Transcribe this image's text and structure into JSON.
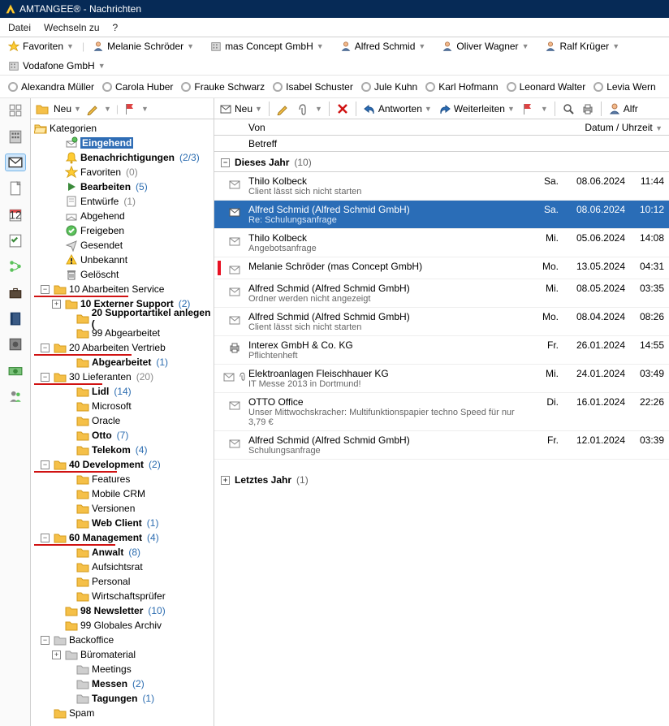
{
  "title": "AMTANGEE® - Nachrichten",
  "menu": {
    "items": [
      "Datei",
      "Wechseln zu",
      "?"
    ]
  },
  "favbar": {
    "favorites_label": "Favoriten",
    "items": [
      {
        "name": "Melanie Schröder",
        "type": "person"
      },
      {
        "name": "mas Concept GmbH",
        "type": "company"
      },
      {
        "name": "Alfred Schmid",
        "type": "person"
      },
      {
        "name": "Oliver Wagner",
        "type": "person"
      },
      {
        "name": "Ralf Krüger",
        "type": "person"
      },
      {
        "name": "Vodafone GmbH",
        "type": "company"
      }
    ]
  },
  "contactbar": {
    "items": [
      "Alexandra Müller",
      "Carola Huber",
      "Frauke Schwarz",
      "Isabel Schuster",
      "Jule Kuhn",
      "Karl Hofmann",
      "Leonard Walter",
      "Levia Wern"
    ]
  },
  "tree_toolbar": {
    "new_label": "Neu"
  },
  "tree": {
    "root": "Kategorien",
    "nodes": [
      {
        "ind": 1,
        "exp": "",
        "icon": "inbox",
        "label": "Eingehend",
        "sel": true,
        "bold": true
      },
      {
        "ind": 1,
        "exp": "",
        "icon": "bell",
        "label": "Benachrichtigungen",
        "cnt": "(2/3)",
        "bold": true
      },
      {
        "ind": 1,
        "exp": "",
        "icon": "star",
        "label": "Favoriten",
        "cnt": "(0)"
      },
      {
        "ind": 1,
        "exp": "",
        "icon": "play",
        "label": "Bearbeiten",
        "cnt": "(5)",
        "bold": true
      },
      {
        "ind": 1,
        "exp": "",
        "icon": "draft",
        "label": "Entwürfe",
        "cnt": "(1)"
      },
      {
        "ind": 1,
        "exp": "",
        "icon": "out",
        "label": "Abgehend"
      },
      {
        "ind": 1,
        "exp": "",
        "icon": "check",
        "label": "Freigeben"
      },
      {
        "ind": 1,
        "exp": "",
        "icon": "sent",
        "label": "Gesendet"
      },
      {
        "ind": 1,
        "exp": "",
        "icon": "warn",
        "label": "Unbekannt"
      },
      {
        "ind": 1,
        "exp": "",
        "icon": "trash",
        "label": "Gelöscht"
      },
      {
        "ind": 0,
        "exp": "-",
        "icon": "folder-y",
        "label": "10 Abarbeiten Service",
        "red": 116
      },
      {
        "ind": 1,
        "exp": "+",
        "icon": "folder-y",
        "label": "10 Externer Support",
        "cnt": "(2)",
        "bold": true
      },
      {
        "ind": 2,
        "exp": "",
        "icon": "folder-y",
        "label": "20 Supportartikel anlegen (",
        "bold": true
      },
      {
        "ind": 2,
        "exp": "",
        "icon": "folder-y",
        "label": "99 Abgearbeitet"
      },
      {
        "ind": 0,
        "exp": "-",
        "icon": "folder-y",
        "label": "20 Abarbeiten Vertrieb",
        "red": 120
      },
      {
        "ind": 2,
        "exp": "",
        "icon": "folder-y",
        "label": "Abgearbeitet",
        "cnt": "(1)",
        "bold": true
      },
      {
        "ind": 0,
        "exp": "-",
        "icon": "folder-y",
        "label": "30 Lieferanten",
        "cnt": "(20)",
        "red": 84
      },
      {
        "ind": 2,
        "exp": "",
        "icon": "folder-y",
        "label": "Lidl",
        "cnt": "(14)",
        "bold": true
      },
      {
        "ind": 2,
        "exp": "",
        "icon": "folder-y",
        "label": "Microsoft"
      },
      {
        "ind": 2,
        "exp": "",
        "icon": "folder-y",
        "label": "Oracle"
      },
      {
        "ind": 2,
        "exp": "",
        "icon": "folder-y",
        "label": "Otto",
        "cnt": "(7)",
        "bold": true
      },
      {
        "ind": 2,
        "exp": "",
        "icon": "folder-y",
        "label": "Telekom",
        "cnt": "(4)",
        "bold": true
      },
      {
        "ind": 0,
        "exp": "-",
        "icon": "folder-y",
        "label": "40 Development",
        "cnt": "(2)",
        "bold": true,
        "red": 102
      },
      {
        "ind": 2,
        "exp": "",
        "icon": "folder-y",
        "label": "Features"
      },
      {
        "ind": 2,
        "exp": "",
        "icon": "folder-y",
        "label": "Mobile CRM"
      },
      {
        "ind": 2,
        "exp": "",
        "icon": "folder-y",
        "label": "Versionen"
      },
      {
        "ind": 2,
        "exp": "",
        "icon": "folder-y",
        "label": "Web Client",
        "cnt": "(1)",
        "bold": true
      },
      {
        "ind": 0,
        "exp": "-",
        "icon": "folder-y",
        "label": "60 Management",
        "cnt": "(4)",
        "bold": true,
        "red": 100
      },
      {
        "ind": 2,
        "exp": "",
        "icon": "folder-y",
        "label": "Anwalt",
        "cnt": "(8)",
        "bold": true
      },
      {
        "ind": 2,
        "exp": "",
        "icon": "folder-y",
        "label": "Aufsichtsrat"
      },
      {
        "ind": 2,
        "exp": "",
        "icon": "folder-y",
        "label": "Personal"
      },
      {
        "ind": 2,
        "exp": "",
        "icon": "folder-y",
        "label": "Wirtschaftsprüfer"
      },
      {
        "ind": 1,
        "exp": "",
        "icon": "folder-y",
        "label": "98 Newsletter",
        "cnt": "(10)",
        "bold": true
      },
      {
        "ind": 1,
        "exp": "",
        "icon": "folder-y",
        "label": "99 Globales Archiv"
      },
      {
        "ind": 0,
        "exp": "-",
        "icon": "folder-g",
        "label": "Backoffice"
      },
      {
        "ind": 1,
        "exp": "+",
        "icon": "folder-g",
        "label": "Büromaterial"
      },
      {
        "ind": 2,
        "exp": "",
        "icon": "folder-g",
        "label": "Meetings"
      },
      {
        "ind": 2,
        "exp": "",
        "icon": "folder-g",
        "label": "Messen",
        "cnt": "(2)",
        "bold": true
      },
      {
        "ind": 2,
        "exp": "",
        "icon": "folder-g",
        "label": "Tagungen",
        "cnt": "(1)",
        "bold": true
      },
      {
        "ind": 0,
        "exp": "",
        "icon": "folder-y",
        "label": "Spam"
      }
    ]
  },
  "list_toolbar": {
    "new": "Neu",
    "edit_tip": "Bearbeiten",
    "attach_tip": "Anhang",
    "delete_tip": "Löschen",
    "reply": "Antworten",
    "forward": "Weiterleiten",
    "alfr": "Alfr"
  },
  "columns": {
    "from": "Von",
    "date": "Datum / Uhrzeit",
    "subject": "Betreff"
  },
  "groups": [
    {
      "label": "Dieses Jahr",
      "count": "(10)",
      "expanded": true
    },
    {
      "label": "Letztes Jahr",
      "count": "(1)",
      "expanded": false
    }
  ],
  "messages": [
    {
      "icon": "open",
      "from": "Thilo Kolbeck",
      "subj": "Client lässt sich nicht starten",
      "day": "Sa.",
      "date": "08.06.2024",
      "time": "11:44"
    },
    {
      "icon": "closed",
      "from": "Alfred Schmid (Alfred Schmid GmbH)",
      "subj": "Re: Schulungsanfrage",
      "day": "Sa.",
      "date": "08.06.2024",
      "time": "10:12",
      "sel": true
    },
    {
      "icon": "open",
      "from": "Thilo Kolbeck",
      "subj": "Angebotsanfrage",
      "day": "Mi.",
      "date": "05.06.2024",
      "time": "14:08"
    },
    {
      "icon": "open",
      "from": "Melanie Schröder (mas Concept GmbH)",
      "subj": "",
      "day": "Mo.",
      "date": "13.05.2024",
      "time": "04:31",
      "flag": "red"
    },
    {
      "icon": "open",
      "from": "Alfred Schmid (Alfred Schmid GmbH)",
      "subj": "Ordner werden nicht angezeigt",
      "day": "Mi.",
      "date": "08.05.2024",
      "time": "03:35"
    },
    {
      "icon": "open",
      "from": "Alfred Schmid (Alfred Schmid GmbH)",
      "subj": "Client lässt sich nicht starten",
      "day": "Mo.",
      "date": "08.04.2024",
      "time": "08:26"
    },
    {
      "icon": "print",
      "from": "Interex GmbH & Co. KG",
      "subj": "Pflichtenheft",
      "day": "Fr.",
      "date": "26.01.2024",
      "time": "14:55"
    },
    {
      "icon": "open",
      "from": "Elektroanlagen Fleischhauer KG",
      "subj": "IT Messe 2013 in Dortmund!",
      "day": "Mi.",
      "date": "24.01.2024",
      "time": "03:49",
      "attach": true
    },
    {
      "icon": "open",
      "from": "OTTO Office",
      "subj": "Unser Mittwochskracher: Multifunktionspapier techno Speed für nur 3,79 €",
      "day": "Di.",
      "date": "16.01.2024",
      "time": "22:26"
    },
    {
      "icon": "open",
      "from": "Alfred Schmid (Alfred Schmid GmbH)",
      "subj": "Schulungsanfrage",
      "day": "Fr.",
      "date": "12.01.2024",
      "time": "03:39"
    }
  ]
}
